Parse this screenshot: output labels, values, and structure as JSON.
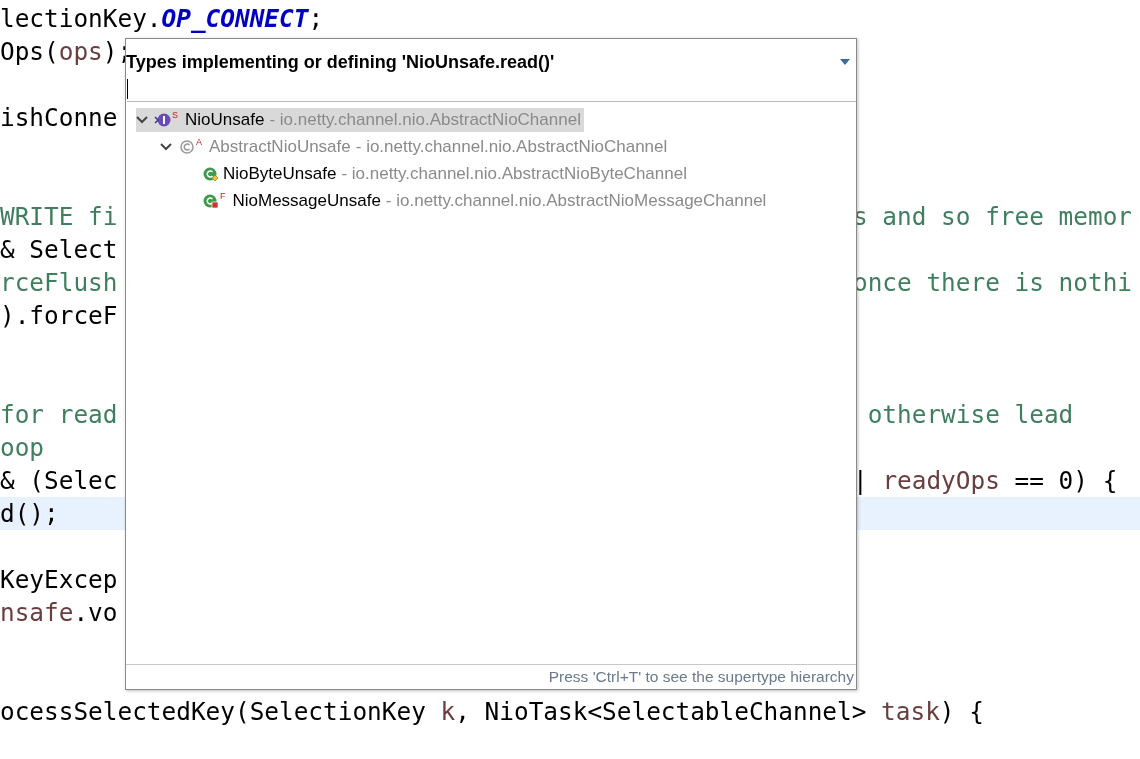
{
  "editor": {
    "lines": [
      {
        "highlighted": false,
        "left": [
          {
            "text": "lectionKey.",
            "kind": "plain"
          },
          {
            "text": "OP_CONNECT",
            "kind": "constant"
          },
          {
            "text": ";",
            "kind": "plain"
          }
        ]
      },
      {
        "highlighted": false,
        "left": [
          {
            "text": "Ops(",
            "kind": "plain"
          },
          {
            "text": "ops",
            "kind": "variable"
          },
          {
            "text": ");",
            "kind": "plain"
          }
        ]
      },
      {
        "highlighted": false
      },
      {
        "highlighted": false,
        "left": [
          {
            "text": "ishConne",
            "kind": "plain"
          }
        ]
      },
      {
        "highlighted": false
      },
      {
        "highlighted": false
      },
      {
        "highlighted": false,
        "left": [
          {
            "text": "WRITE fi",
            "kind": "comment"
          }
        ],
        "right": [
          {
            "text": "s and so free memor",
            "kind": "comment"
          }
        ]
      },
      {
        "highlighted": false,
        "left": [
          {
            "text": "& Select",
            "kind": "plain"
          }
        ]
      },
      {
        "highlighted": false,
        "left": [
          {
            "text": "rceFlush",
            "kind": "comment"
          }
        ],
        "right": [
          {
            "text": "once there is nothi",
            "kind": "comment"
          }
        ]
      },
      {
        "highlighted": false,
        "left": [
          {
            "text": ").forceF",
            "kind": "plain"
          }
        ]
      },
      {
        "highlighted": false
      },
      {
        "highlighted": false
      },
      {
        "highlighted": false,
        "left": [
          {
            "text": "for read",
            "kind": "comment"
          }
        ],
        "right": [
          {
            "text": " otherwise lead",
            "kind": "comment"
          }
        ]
      },
      {
        "highlighted": false,
        "left": [
          {
            "text": "oop",
            "kind": "comment"
          }
        ]
      },
      {
        "highlighted": false,
        "left": [
          {
            "text": "& (Selec",
            "kind": "plain"
          }
        ],
        "right": [
          {
            "text": "| ",
            "kind": "plain"
          },
          {
            "text": "readyOps",
            "kind": "variable"
          },
          {
            "text": " == 0) {",
            "kind": "plain"
          }
        ]
      },
      {
        "highlighted": true,
        "left": [
          {
            "text": "d();",
            "kind": "plain"
          }
        ]
      },
      {
        "highlighted": false
      },
      {
        "highlighted": false,
        "left": [
          {
            "text": "KeyExcep",
            "kind": "plain"
          }
        ]
      },
      {
        "highlighted": false,
        "left": [
          {
            "text": "nsafe",
            "kind": "variable"
          },
          {
            "text": ".vo",
            "kind": "plain"
          }
        ]
      },
      {
        "highlighted": false
      },
      {
        "highlighted": false
      },
      {
        "highlighted": false,
        "left": [
          {
            "text": "ocessSelectedKey(SelectionKey ",
            "kind": "plain"
          },
          {
            "text": "k",
            "kind": "variable"
          },
          {
            "text": ", NioTask<SelectableChannel> ",
            "kind": "plain"
          },
          {
            "text": "task",
            "kind": "variable"
          },
          {
            "text": ") {",
            "kind": "plain"
          }
        ]
      }
    ]
  },
  "popup": {
    "title": "Types implementing or defining 'NioUnsafe.read()'",
    "tree": [
      {
        "name": "NioUnsafe",
        "detail": "- io.netty.channel.nio.AbstractNioChannel",
        "kind": "interface",
        "badge": "S",
        "selected": true,
        "dimmed": false,
        "expanded": true,
        "children": [
          {
            "name": "AbstractNioUnsafe",
            "detail": "- io.netty.channel.nio.AbstractNioChannel",
            "kind": "abstract",
            "badge": "A",
            "selected": false,
            "dimmed": true,
            "expanded": true,
            "children": [
              {
                "name": "NioByteUnsafe",
                "detail": "- io.netty.channel.nio.AbstractNioByteChannel",
                "kind": "default",
                "selected": false,
                "dimmed": false
              },
              {
                "name": "NioMessageUnsafe",
                "detail": "- io.netty.channel.nio.AbstractNioMessageChannel",
                "kind": "private",
                "badge": "F",
                "selected": false,
                "dimmed": false
              }
            ]
          }
        ]
      }
    ],
    "footer": "Press 'Ctrl+T' to see the supertype hierarchy"
  }
}
